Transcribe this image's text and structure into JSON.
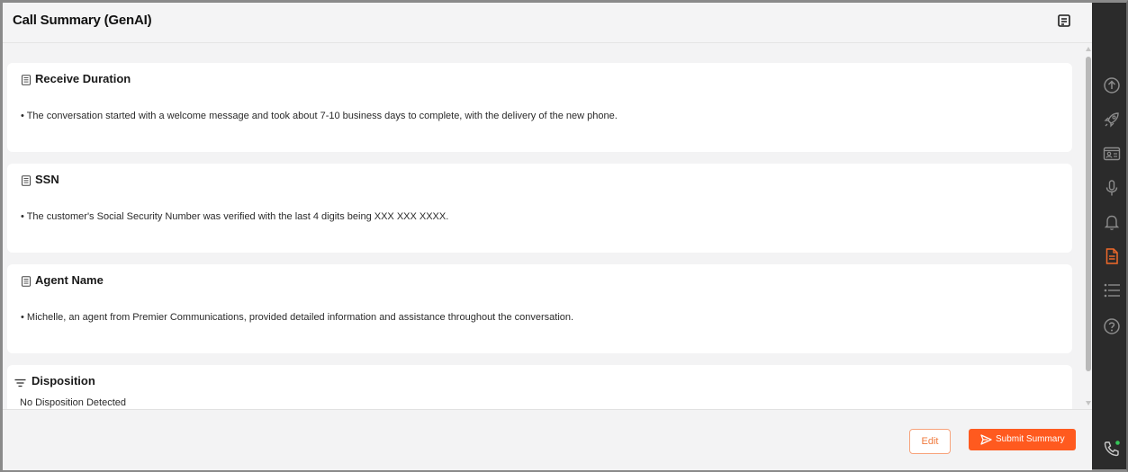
{
  "header": {
    "title": "Call Summary (GenAI)",
    "icon": "notes-icon"
  },
  "cards": [
    {
      "title": "Receive Duration",
      "icon": "document-icon",
      "text": "• The conversation started with a welcome message and took about 7-10 business days to complete, with the delivery of the new phone."
    },
    {
      "title": "SSN",
      "icon": "document-icon",
      "text": "• The customer's Social Security Number was verified with the last 4 digits being XXX XXX XXXX."
    },
    {
      "title": "Agent Name",
      "icon": "document-icon",
      "text": "• Michelle, an agent from Premier Communications, provided detailed information and assistance throughout the conversation."
    },
    {
      "title": "Disposition",
      "icon": "filter-icon",
      "text": "No Disposition Detected"
    }
  ],
  "footer": {
    "edit_label": "Edit",
    "submit_label": "Submit Summary"
  },
  "rail": {
    "items": [
      "upload-icon",
      "rocket-icon",
      "contact-card-icon",
      "microphone-icon",
      "bell-icon",
      "document-icon",
      "list-icon",
      "help-icon"
    ],
    "active": "document-icon",
    "bottom": "phone-icon"
  },
  "colors": {
    "accent": "#ff5a1f",
    "rail_bg": "#2b2b2b",
    "rail_icon": "#8c8c8c",
    "active_icon": "#f26a2a",
    "status_dot": "#35c759"
  }
}
